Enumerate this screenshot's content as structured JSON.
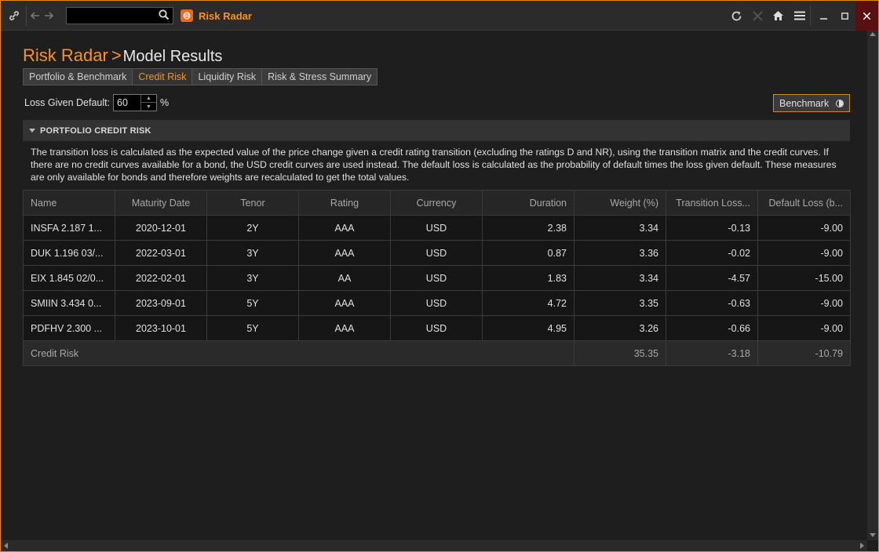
{
  "titlebar": {
    "app_title": "Risk Radar",
    "search_value": "",
    "colors": {
      "accent": "#f7931e",
      "border": "#e08a1e"
    }
  },
  "breadcrumb": {
    "main": "Risk Radar",
    "separator": ">",
    "sub": "Model Results"
  },
  "tabs": [
    {
      "label": "Portfolio & Benchmark",
      "active": false
    },
    {
      "label": "Credit Risk",
      "active": true
    },
    {
      "label": "Liquidity Risk",
      "active": false
    },
    {
      "label": "Risk & Stress Summary",
      "active": false
    }
  ],
  "lgd": {
    "label": "Loss Given Default:",
    "value": "60",
    "unit": "%"
  },
  "benchmark_button": {
    "label": "Benchmark"
  },
  "section": {
    "title": "PORTFOLIO CREDIT RISK",
    "description": "The transition loss is calculated as the expected value of the price change given a credit rating transition (excluding the ratings D and NR), using the transition matrix and the credit curves. If there are no credit curves available for a bond, the USD credit curves are used instead. The default loss is calculated as the probability of default times the loss given default. These measures are only available for bonds and therefore weights are recalculated to get the total values."
  },
  "table": {
    "headers": [
      "Name",
      "Maturity Date",
      "Tenor",
      "Rating",
      "Currency",
      "Duration",
      "Weight (%)",
      "Transition Loss...",
      "Default Loss (b..."
    ],
    "rows": [
      [
        "INSFA 2.187 1...",
        "2020-12-01",
        "2Y",
        "AAA",
        "USD",
        "2.38",
        "3.34",
        "-0.13",
        "-9.00"
      ],
      [
        "DUK 1.196 03/...",
        "2022-03-01",
        "3Y",
        "AAA",
        "USD",
        "0.87",
        "3.36",
        "-0.02",
        "-9.00"
      ],
      [
        "EIX 1.845 02/0...",
        "2022-02-01",
        "3Y",
        "AA",
        "USD",
        "1.83",
        "3.34",
        "-4.57",
        "-15.00"
      ],
      [
        "SMIIN 3.434 0...",
        "2023-09-01",
        "5Y",
        "AAA",
        "USD",
        "4.72",
        "3.35",
        "-0.63",
        "-9.00"
      ],
      [
        "PDFHV 2.300 ...",
        "2023-10-01",
        "5Y",
        "AAA",
        "USD",
        "4.95",
        "3.26",
        "-0.66",
        "-9.00"
      ]
    ],
    "total": {
      "label": "Credit Risk",
      "weight": "35.35",
      "transition": "-3.18",
      "default": "-10.79"
    }
  }
}
